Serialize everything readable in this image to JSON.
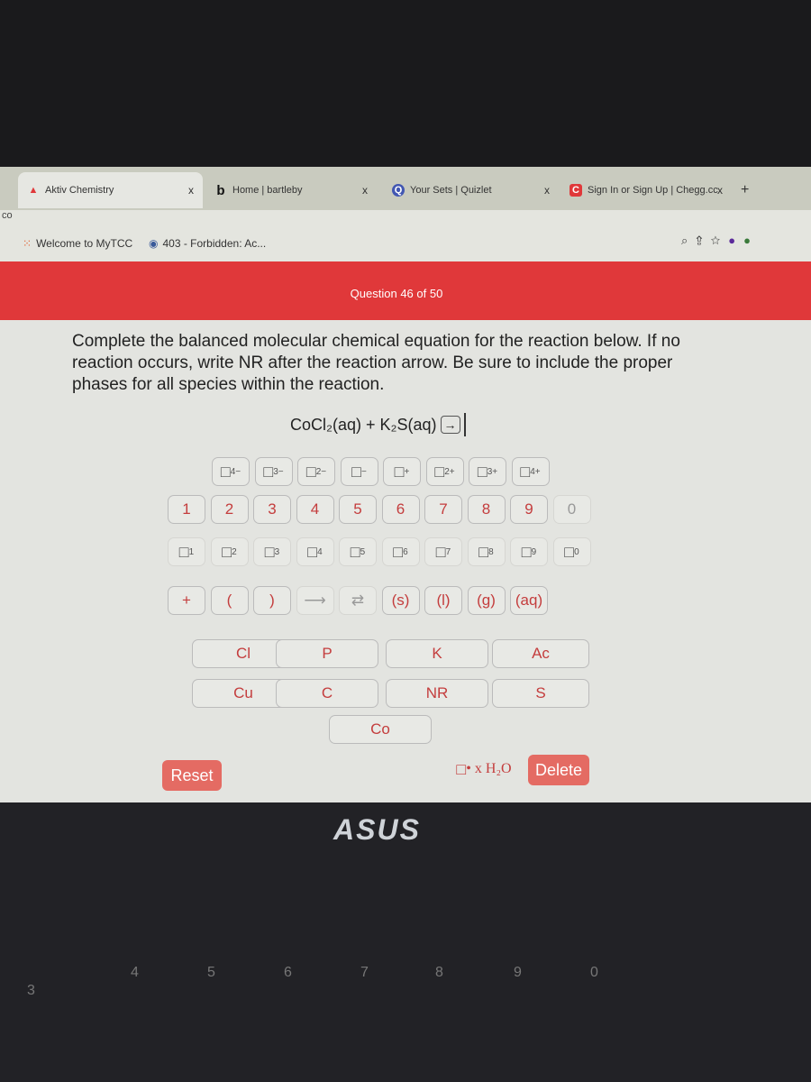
{
  "browser": {
    "tabs": [
      {
        "title": "Aktiv Chemistry",
        "icon": "aktiv-logo",
        "active": true
      },
      {
        "title": "Home | bartleby",
        "icon": "bartleby-logo"
      },
      {
        "title": "Your Sets | Quizlet",
        "icon": "quizlet-logo"
      },
      {
        "title": "Sign In or Sign Up | Chegg.cc",
        "icon": "chegg-logo"
      }
    ],
    "close": "x",
    "new_tab": "+",
    "bookmarks": [
      {
        "label": "Welcome to MyTCC"
      },
      {
        "label": "403 - Forbidden: Ac..."
      }
    ],
    "address_fragment": "co"
  },
  "header": {
    "question": "Question 46 of 50",
    "accent": "#e0383a"
  },
  "prompt": "Complete the balanced molecular chemical equation for the reaction below. If no reaction occurs, write NR after the reaction arrow. Be sure to include the proper phases for all species within the reaction.",
  "equation": {
    "left": "CoCl₂(aq) + K₂S(aq)",
    "arrow": "→"
  },
  "keypad": {
    "charges": [
      "4−",
      "3−",
      "2−",
      "−",
      "+",
      "2+",
      "3+",
      "4+"
    ],
    "digits": [
      "1",
      "2",
      "3",
      "4",
      "5",
      "6",
      "7",
      "8",
      "9",
      "0"
    ],
    "subscripts": [
      "1",
      "2",
      "3",
      "4",
      "5",
      "6",
      "7",
      "8",
      "9",
      "0"
    ],
    "symbols": [
      "+",
      "(",
      ")",
      "⟶",
      "⇄",
      "(s)",
      "(l)",
      "(g)",
      "(aq)"
    ],
    "elements": [
      "Cl",
      "P",
      "K",
      "Ac",
      "Cu",
      "C",
      "NR",
      "S",
      "Co"
    ],
    "water": "• x H₂O",
    "reset": "Reset",
    "delete": "Delete"
  },
  "laptop": {
    "brand": "ASUS"
  }
}
